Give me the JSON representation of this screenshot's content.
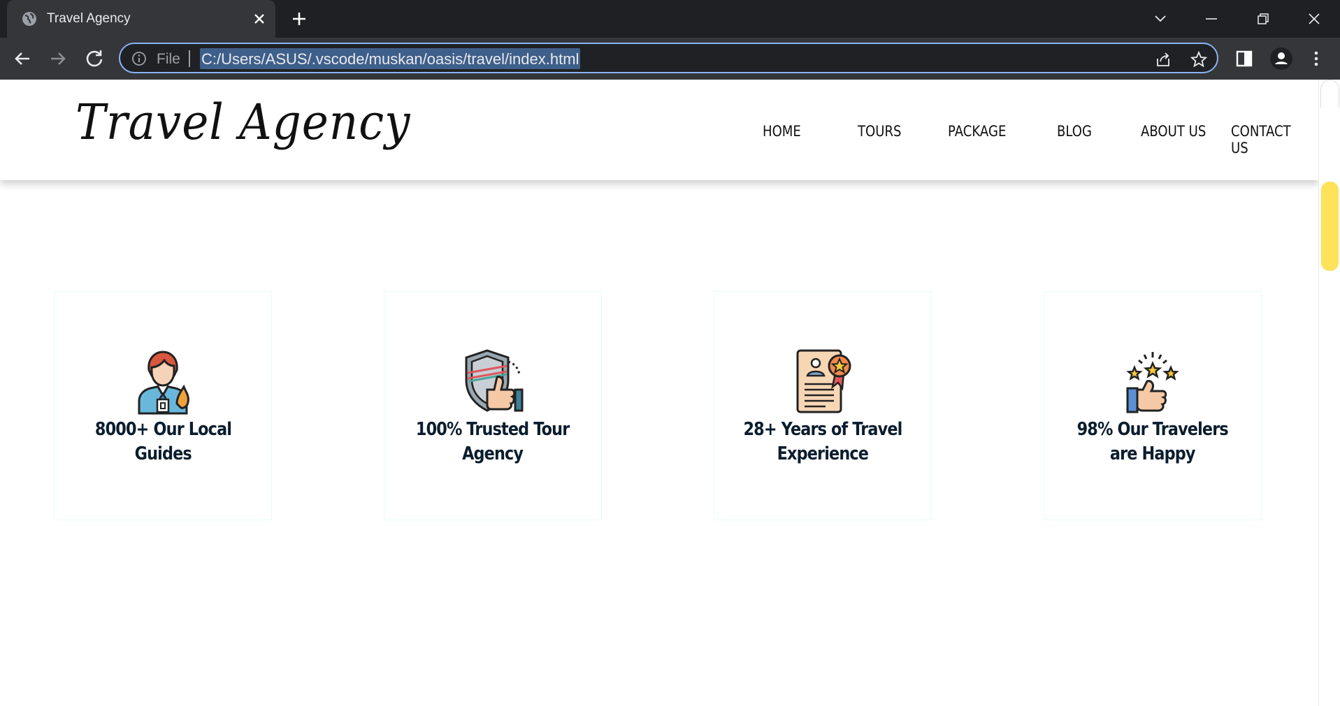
{
  "browser": {
    "tab_title": "Travel Agency",
    "scheme_label": "File",
    "url": "C:/Users/ASUS/.vscode/muskan/oasis/travel/index.html",
    "icons": [
      "globe-icon",
      "close-icon",
      "plus-icon",
      "chevron-down-icon",
      "minimize-icon",
      "restore-icon",
      "window-close-icon",
      "back-arrow-icon",
      "forward-arrow-icon",
      "reload-icon",
      "info-icon",
      "share-icon",
      "star-icon",
      "side-panel-icon",
      "profile-icon",
      "more-icon"
    ]
  },
  "site": {
    "logo": "Travel Agency",
    "menu": [
      "HOME",
      "TOURS",
      "PACKAGE",
      "BLOG",
      "ABOUT US",
      "CONTACT US"
    ],
    "features": [
      {
        "line1": "8000+ Our Local",
        "line2": "Guides",
        "icon": "guide-icon"
      },
      {
        "line1": "100% Trusted Tour",
        "line2": "Agency",
        "icon": "shield-thumbs-up-icon"
      },
      {
        "line1": "28+ Years of Travel",
        "line2": "Experience",
        "icon": "certificate-icon"
      },
      {
        "line1": "98% Our Travelers",
        "line2": "are Happy",
        "icon": "stars-thumbs-up-icon"
      }
    ]
  },
  "colors": {
    "chrome_dark": "#1f2023",
    "chrome_toolbar": "#35363a",
    "focus_ring": "#8ab4f8",
    "scroll_thumb": "#fde25a",
    "card_text": "#0b1d2e"
  }
}
